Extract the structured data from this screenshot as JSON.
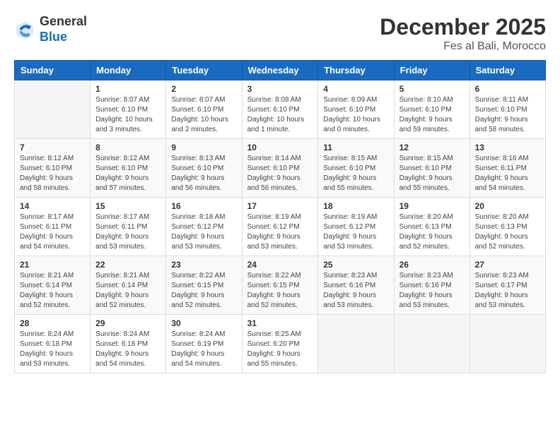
{
  "header": {
    "logo_line1": "General",
    "logo_line2": "Blue",
    "month": "December 2025",
    "location": "Fes al Bali, Morocco"
  },
  "weekdays": [
    "Sunday",
    "Monday",
    "Tuesday",
    "Wednesday",
    "Thursday",
    "Friday",
    "Saturday"
  ],
  "weeks": [
    [
      {
        "day": "",
        "info": ""
      },
      {
        "day": "1",
        "info": "Sunrise: 8:07 AM\nSunset: 6:10 PM\nDaylight: 10 hours\nand 3 minutes."
      },
      {
        "day": "2",
        "info": "Sunrise: 8:07 AM\nSunset: 6:10 PM\nDaylight: 10 hours\nand 2 minutes."
      },
      {
        "day": "3",
        "info": "Sunrise: 8:08 AM\nSunset: 6:10 PM\nDaylight: 10 hours\nand 1 minute."
      },
      {
        "day": "4",
        "info": "Sunrise: 8:09 AM\nSunset: 6:10 PM\nDaylight: 10 hours\nand 0 minutes."
      },
      {
        "day": "5",
        "info": "Sunrise: 8:10 AM\nSunset: 6:10 PM\nDaylight: 9 hours\nand 59 minutes."
      },
      {
        "day": "6",
        "info": "Sunrise: 8:11 AM\nSunset: 6:10 PM\nDaylight: 9 hours\nand 58 minutes."
      }
    ],
    [
      {
        "day": "7",
        "info": "Sunrise: 8:12 AM\nSunset: 6:10 PM\nDaylight: 9 hours\nand 58 minutes."
      },
      {
        "day": "8",
        "info": "Sunrise: 8:12 AM\nSunset: 6:10 PM\nDaylight: 9 hours\nand 57 minutes."
      },
      {
        "day": "9",
        "info": "Sunrise: 8:13 AM\nSunset: 6:10 PM\nDaylight: 9 hours\nand 56 minutes."
      },
      {
        "day": "10",
        "info": "Sunrise: 8:14 AM\nSunset: 6:10 PM\nDaylight: 9 hours\nand 56 minutes."
      },
      {
        "day": "11",
        "info": "Sunrise: 8:15 AM\nSunset: 6:10 PM\nDaylight: 9 hours\nand 55 minutes."
      },
      {
        "day": "12",
        "info": "Sunrise: 8:15 AM\nSunset: 6:10 PM\nDaylight: 9 hours\nand 55 minutes."
      },
      {
        "day": "13",
        "info": "Sunrise: 8:16 AM\nSunset: 6:11 PM\nDaylight: 9 hours\nand 54 minutes."
      }
    ],
    [
      {
        "day": "14",
        "info": "Sunrise: 8:17 AM\nSunset: 6:11 PM\nDaylight: 9 hours\nand 54 minutes."
      },
      {
        "day": "15",
        "info": "Sunrise: 8:17 AM\nSunset: 6:11 PM\nDaylight: 9 hours\nand 53 minutes."
      },
      {
        "day": "16",
        "info": "Sunrise: 8:18 AM\nSunset: 6:12 PM\nDaylight: 9 hours\nand 53 minutes."
      },
      {
        "day": "17",
        "info": "Sunrise: 8:19 AM\nSunset: 6:12 PM\nDaylight: 9 hours\nand 53 minutes."
      },
      {
        "day": "18",
        "info": "Sunrise: 8:19 AM\nSunset: 6:12 PM\nDaylight: 9 hours\nand 53 minutes."
      },
      {
        "day": "19",
        "info": "Sunrise: 8:20 AM\nSunset: 6:13 PM\nDaylight: 9 hours\nand 52 minutes."
      },
      {
        "day": "20",
        "info": "Sunrise: 8:20 AM\nSunset: 6:13 PM\nDaylight: 9 hours\nand 52 minutes."
      }
    ],
    [
      {
        "day": "21",
        "info": "Sunrise: 8:21 AM\nSunset: 6:14 PM\nDaylight: 9 hours\nand 52 minutes."
      },
      {
        "day": "22",
        "info": "Sunrise: 8:21 AM\nSunset: 6:14 PM\nDaylight: 9 hours\nand 52 minutes."
      },
      {
        "day": "23",
        "info": "Sunrise: 8:22 AM\nSunset: 6:15 PM\nDaylight: 9 hours\nand 52 minutes."
      },
      {
        "day": "24",
        "info": "Sunrise: 8:22 AM\nSunset: 6:15 PM\nDaylight: 9 hours\nand 52 minutes."
      },
      {
        "day": "25",
        "info": "Sunrise: 8:23 AM\nSunset: 6:16 PM\nDaylight: 9 hours\nand 53 minutes."
      },
      {
        "day": "26",
        "info": "Sunrise: 8:23 AM\nSunset: 6:16 PM\nDaylight: 9 hours\nand 53 minutes."
      },
      {
        "day": "27",
        "info": "Sunrise: 8:23 AM\nSunset: 6:17 PM\nDaylight: 9 hours\nand 53 minutes."
      }
    ],
    [
      {
        "day": "28",
        "info": "Sunrise: 8:24 AM\nSunset: 6:18 PM\nDaylight: 9 hours\nand 53 minutes."
      },
      {
        "day": "29",
        "info": "Sunrise: 8:24 AM\nSunset: 6:18 PM\nDaylight: 9 hours\nand 54 minutes."
      },
      {
        "day": "30",
        "info": "Sunrise: 8:24 AM\nSunset: 6:19 PM\nDaylight: 9 hours\nand 54 minutes."
      },
      {
        "day": "31",
        "info": "Sunrise: 8:25 AM\nSunset: 6:20 PM\nDaylight: 9 hours\nand 55 minutes."
      },
      {
        "day": "",
        "info": ""
      },
      {
        "day": "",
        "info": ""
      },
      {
        "day": "",
        "info": ""
      }
    ]
  ]
}
